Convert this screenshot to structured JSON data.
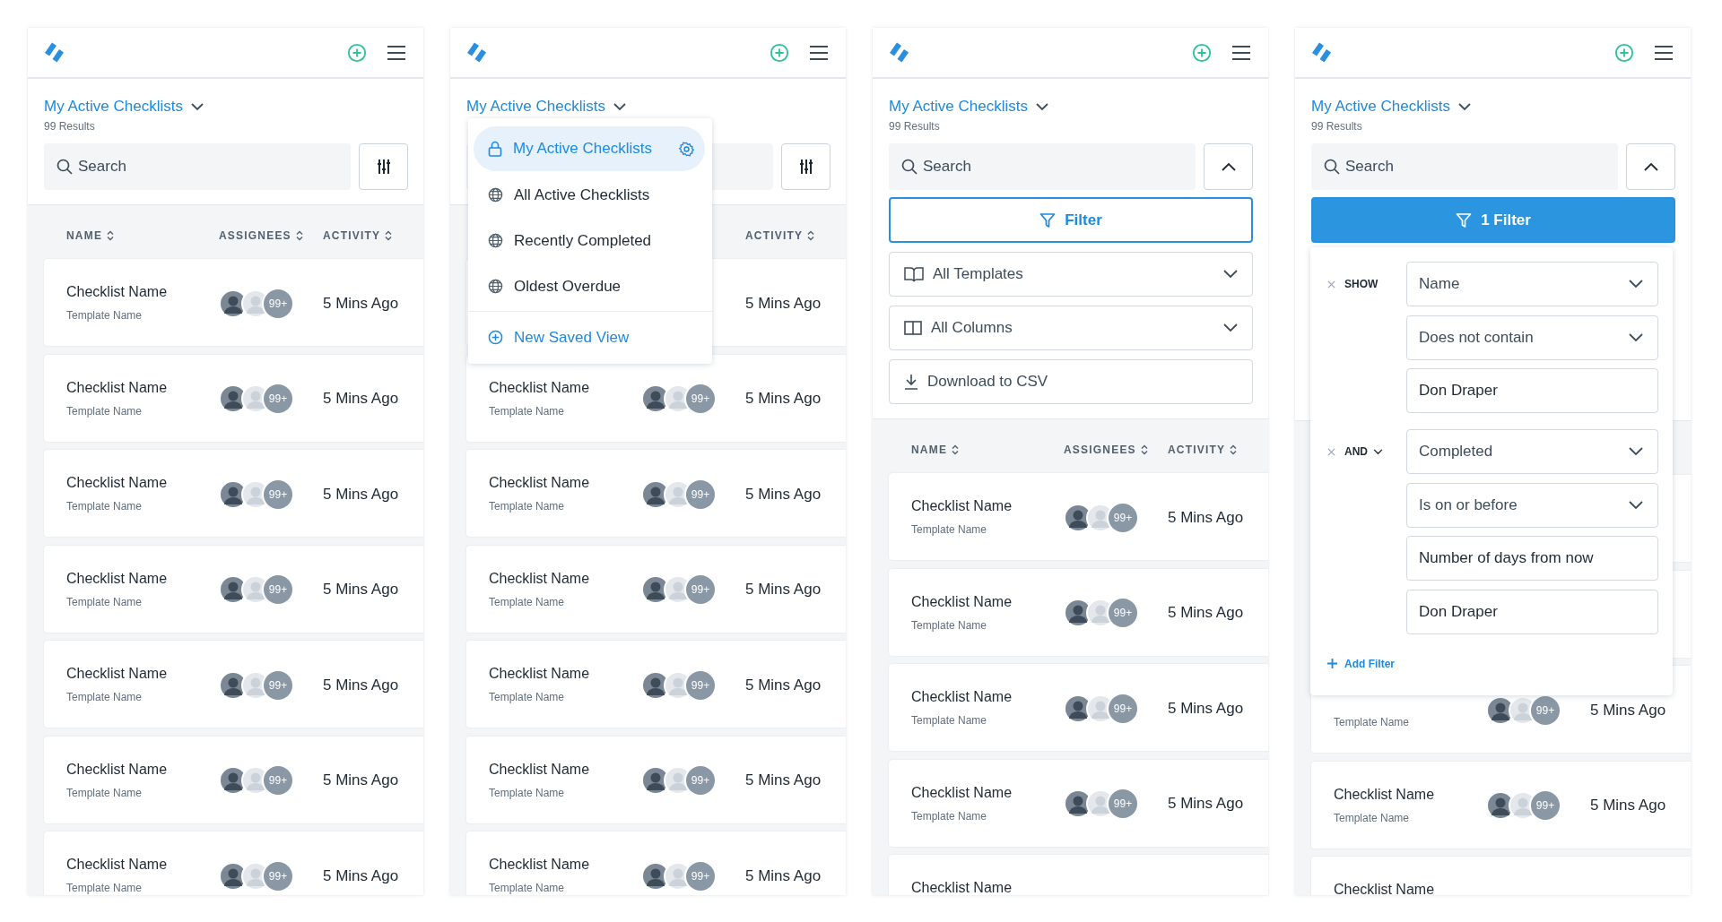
{
  "panels": [
    {
      "view": {
        "title": "My Active Checklists",
        "results": "99 Results"
      },
      "search": {
        "placeholder": "Search"
      },
      "toolbar_toggle": {
        "expanded": false
      },
      "columns": [
        {
          "label": "NAME",
          "sortable": true
        },
        {
          "label": "ASSIGNEES",
          "sortable": true
        },
        {
          "label": "ACTIVITY",
          "sortable": true
        }
      ],
      "rows": [
        {
          "name": "Checklist Name",
          "template": "Template Name",
          "avatars": [
            {
              "kind": "photo"
            },
            {
              "kind": "photo"
            }
          ],
          "more": "99+",
          "activity": "5 Mins Ago"
        },
        {
          "name": "Checklist Name",
          "template": "Template Name",
          "avatars": [
            {
              "kind": "photo"
            },
            {
              "kind": "photo"
            }
          ],
          "more": "99+",
          "activity": "5 Mins Ago"
        },
        {
          "name": "Checklist Name",
          "template": "Template Name",
          "avatars": [
            {
              "kind": "photo"
            },
            {
              "kind": "photo"
            }
          ],
          "more": "99+",
          "activity": "5 Mins Ago"
        },
        {
          "name": "Checklist Name",
          "template": "Template Name",
          "avatars": [
            {
              "kind": "photo"
            },
            {
              "kind": "photo"
            }
          ],
          "more": "99+",
          "activity": "5 Mins Ago"
        },
        {
          "name": "Checklist Name",
          "template": "Template Name",
          "avatars": [
            {
              "kind": "photo"
            },
            {
              "kind": "photo"
            }
          ],
          "more": "99+",
          "activity": "5 Mins Ago"
        },
        {
          "name": "Checklist Name",
          "template": "Template Name",
          "avatars": [
            {
              "kind": "photo"
            },
            {
              "kind": "photo"
            }
          ],
          "more": "99+",
          "activity": "5 Mins Ago"
        },
        {
          "name": "Checklist Name",
          "template": "Template Name",
          "avatars": [
            {
              "kind": "photo"
            },
            {
              "kind": "photo"
            }
          ],
          "more": "99+",
          "activity": "5 Mins Ago"
        }
      ]
    },
    {
      "view": {
        "title": "My Active Checklists"
      },
      "toolbar_toggle": {
        "expanded": false
      },
      "columns": [
        {},
        {},
        {
          "label": "ACTIVITY",
          "sortable": true
        }
      ],
      "rows": [
        {
          "activity": "5 Mins Ago"
        },
        {
          "name": "Checklist Name",
          "template": "Template Name",
          "avatars": [
            {
              "kind": "photo"
            },
            {
              "kind": "photo"
            }
          ],
          "more": "99+",
          "activity": "5 Mins Ago"
        },
        {
          "name": "Checklist Name",
          "template": "Template Name",
          "avatars": [
            {
              "kind": "photo"
            },
            {
              "kind": "photo"
            }
          ],
          "more": "99+",
          "activity": "5 Mins Ago"
        },
        {
          "name": "Checklist Name",
          "template": "Template Name",
          "avatars": [
            {
              "kind": "photo"
            },
            {
              "kind": "photo"
            }
          ],
          "more": "99+",
          "activity": "5 Mins Ago"
        },
        {
          "name": "Checklist Name",
          "template": "Template Name",
          "avatars": [
            {
              "kind": "photo"
            },
            {
              "kind": "photo"
            }
          ],
          "more": "99+",
          "activity": "5 Mins Ago"
        },
        {
          "name": "Checklist Name",
          "template": "Template Name",
          "avatars": [
            {
              "kind": "photo"
            },
            {
              "kind": "photo"
            }
          ],
          "more": "99+",
          "activity": "5 Mins Ago"
        },
        {
          "name": "Checklist Name",
          "template": "Template Name",
          "avatars": [
            {
              "kind": "photo"
            },
            {
              "kind": "photo"
            }
          ],
          "more": "99+",
          "activity": "5 Mins Ago"
        }
      ],
      "dropdown": {
        "items": [
          {
            "label": "My Active Checklists",
            "kind": "private",
            "selected": true
          },
          {
            "label": "All Active Checklists",
            "kind": "shared",
            "selected": false
          },
          {
            "label": "Recently Completed",
            "kind": "shared",
            "selected": false
          },
          {
            "label": "Oldest Overdue",
            "kind": "shared",
            "selected": false
          }
        ],
        "action": "New Saved View"
      }
    },
    {
      "view": {
        "title": "My Active Checklists",
        "results": "99 Results"
      },
      "search": {
        "placeholder": "Search"
      },
      "toolbar_toggle": {
        "expanded": true
      },
      "filter_button": {
        "label": "Filter",
        "active": false
      },
      "tools": [
        {
          "kind": "templates",
          "label": "All Templates"
        },
        {
          "kind": "columns",
          "label": "All Columns"
        },
        {
          "kind": "download",
          "label": "Download to CSV"
        }
      ],
      "columns": [
        {
          "label": "NAME",
          "sortable": true
        },
        {
          "label": "ASSIGNEES",
          "sortable": true
        },
        {
          "label": "ACTIVITY",
          "sortable": true
        }
      ],
      "rows": [
        {
          "name": "Checklist Name",
          "template": "Template Name",
          "avatars": [
            {
              "kind": "photo"
            },
            {
              "kind": "photo"
            }
          ],
          "more": "99+",
          "activity": "5 Mins Ago"
        },
        {
          "name": "Checklist Name",
          "template": "Template Name",
          "avatars": [
            {
              "kind": "photo"
            },
            {
              "kind": "photo"
            }
          ],
          "more": "99+",
          "activity": "5 Mins Ago"
        },
        {
          "name": "Checklist Name",
          "template": "Template Name",
          "avatars": [
            {
              "kind": "photo"
            },
            {
              "kind": "photo"
            }
          ],
          "more": "99+",
          "activity": "5 Mins Ago"
        },
        {
          "name": "Checklist Name",
          "template": "Template Name",
          "avatars": [
            {
              "kind": "photo"
            },
            {
              "kind": "photo"
            }
          ],
          "more": "99+",
          "activity": "5 Mins Ago"
        },
        {
          "name": "Checklist Name"
        }
      ]
    },
    {
      "view": {
        "title": "My Active Checklists",
        "results": "99 Results"
      },
      "search": {
        "placeholder": "Search"
      },
      "toolbar_toggle": {
        "expanded": true
      },
      "filter_button": {
        "label": "1 Filter",
        "active": true
      },
      "filter_popover": {
        "groups": [
          {
            "connector": "SHOW",
            "connector_menu": false,
            "fields": [
              {
                "kind": "select",
                "value": "Name"
              },
              {
                "kind": "select",
                "value": "Does not contain"
              },
              {
                "kind": "input",
                "value": "Don Draper"
              }
            ]
          },
          {
            "connector": "AND",
            "connector_menu": true,
            "fields": [
              {
                "kind": "select",
                "value": "Completed"
              },
              {
                "kind": "select",
                "value": "Is on or before"
              },
              {
                "kind": "input",
                "value": "Number of days from now"
              },
              {
                "kind": "input",
                "value": "Don Draper"
              }
            ]
          }
        ],
        "add_label": "Add Filter"
      },
      "rows": [
        {},
        {},
        {
          "template": "Template Name",
          "avatars": [
            {
              "kind": "photo"
            },
            {
              "kind": "photo"
            }
          ],
          "more": "99+",
          "activity": "5 Mins Ago"
        },
        {
          "name": "Checklist Name",
          "template": "Template Name",
          "avatars": [
            {
              "kind": "photo"
            },
            {
              "kind": "photo"
            }
          ],
          "more": "99+",
          "activity": "5 Mins Ago"
        },
        {
          "name": "Checklist Name"
        }
      ]
    }
  ]
}
